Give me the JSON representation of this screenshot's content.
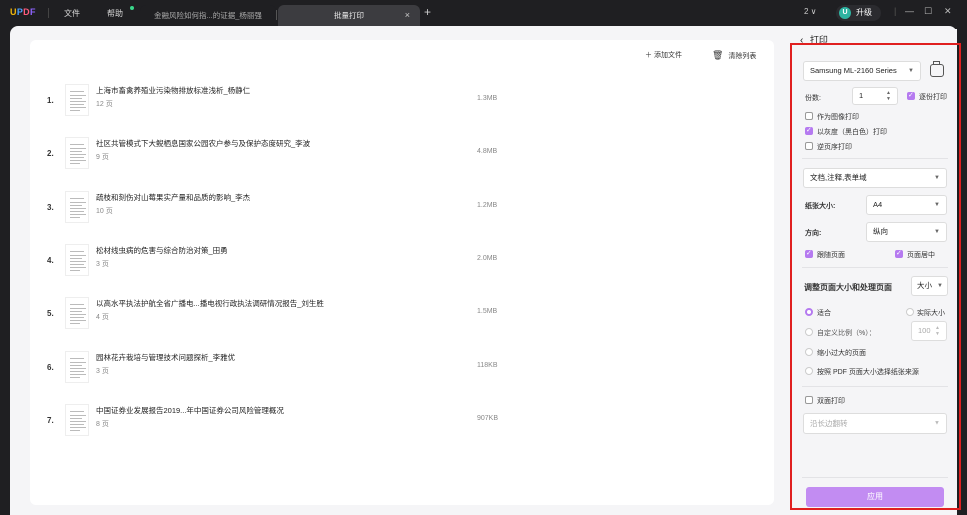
{
  "titlebar": {
    "logo": "UPDF",
    "menu_file": "文件",
    "menu_help": "帮助",
    "tab_doc": "金融风险如何指...的证据_杨丽强",
    "tab_batch": "批量打印",
    "tab_close": "×",
    "new_tab": "+",
    "window_count": "2 ∨",
    "upgrade_icon": "U",
    "upgrade_label": "升级",
    "separator_glyph": "|",
    "min_glyph": "—",
    "max_glyph": "☐",
    "close_glyph": "✕"
  },
  "toolbar": {
    "add_file": "＋  添加文件",
    "clear_list": "清除列表"
  },
  "files": [
    {
      "num": "1.",
      "name": "上海市畜禽养殖业污染物排放标准浅析_杨静仁",
      "pages": "12 页",
      "size": "1.3MB"
    },
    {
      "num": "2.",
      "name": "社区共管模式下大鲵栖息国家公园农户参与及保护态度研究_李波",
      "pages": "9 页",
      "size": "4.8MB"
    },
    {
      "num": "3.",
      "name": "疏枝和刻伤对山莓果实产量和品质的影响_李杰",
      "pages": "10 页",
      "size": "1.2MB"
    },
    {
      "num": "4.",
      "name": "松材线虫病的危害与综合防治对策_田勇",
      "pages": "3 页",
      "size": "2.0MB"
    },
    {
      "num": "5.",
      "name": "以高水平执法护航全省广播电...播电视行政执法调研情况报告_刘生胜",
      "pages": "4 页",
      "size": "1.5MB"
    },
    {
      "num": "6.",
      "name": "园林花卉栽培与管理技术问题探析_李雅优",
      "pages": "3 页",
      "size": "118KB"
    },
    {
      "num": "7.",
      "name": "中国证券业发展报告2019...年中国证券公司风险管理概况",
      "pages": "8 页",
      "size": "907KB"
    }
  ],
  "print_panel": {
    "back": "‹",
    "title": "打印",
    "printer": "Samsung ML-2160 Series",
    "copies_label": "份数:",
    "copies_value": "1",
    "collate": "逐份打印",
    "print_as_image": "作为图像打印",
    "grayscale": "以灰度（黑白色）打印",
    "reverse": "逆页序打印",
    "content": "文档,注释,表单域",
    "paper_size_label": "纸张大小:",
    "paper_size": "A4",
    "orientation_label": "方向:",
    "orientation": "纵向",
    "follow_page": "跟随页面",
    "center_page": "页面居中",
    "resize_label": "调整页面大小和处理页面",
    "resize_mode": "大小",
    "fit": "适合",
    "actual_size": "实际大小",
    "custom_scale": "自定义比例（%）：",
    "custom_scale_value": "100",
    "shrink": "缩小过大的页面",
    "by_pdf_size": "按照 PDF 页面大小选择纸张来源",
    "duplex": "双面打印",
    "flip": "沿长边翻转",
    "apply": "应用"
  },
  "colors": {
    "accent": "#c28cf2",
    "highlight_border": "#e02020"
  }
}
